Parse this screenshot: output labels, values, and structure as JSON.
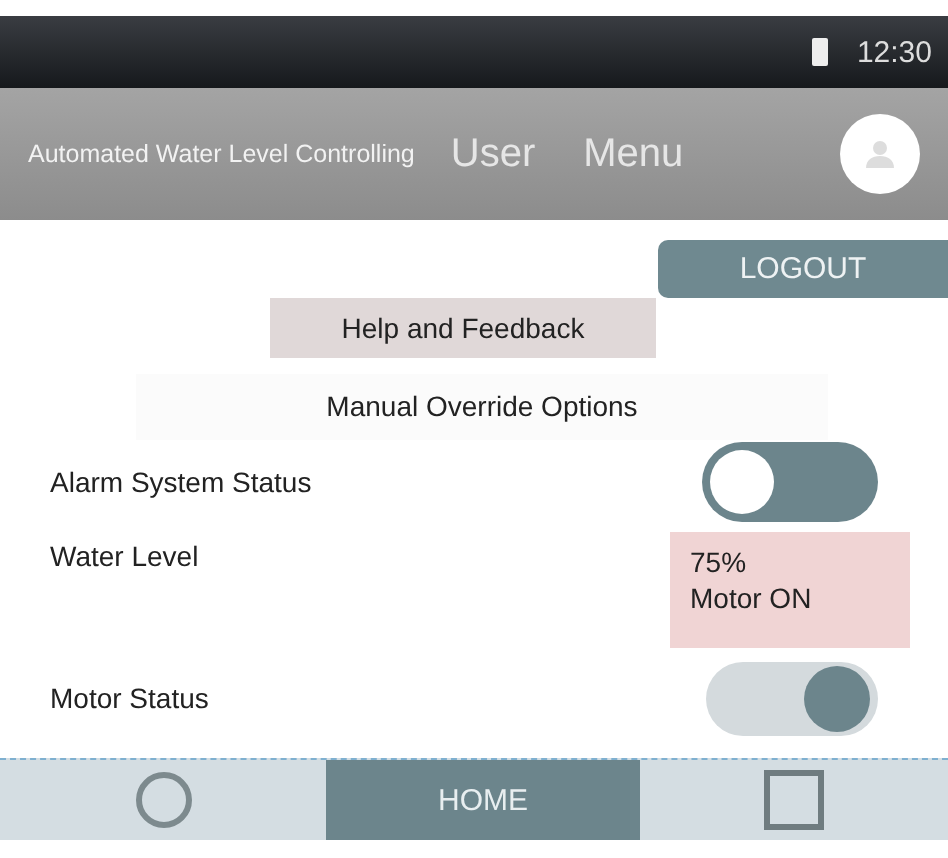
{
  "status_bar": {
    "time": "12:30"
  },
  "header": {
    "title": "Automated Water Level Controlling",
    "links": [
      "User",
      "Menu"
    ]
  },
  "logout_button": "LOGOUT",
  "help_button": "Help and Feedback",
  "section_title": "Manual Override Options",
  "rows": [
    {
      "kind": "toggle",
      "label": "Alarm System Status",
      "on": false
    },
    {
      "kind": "reading",
      "label": "Water Level",
      "lines": [
        "75%",
        "Motor ON"
      ]
    },
    {
      "kind": "toggle",
      "label": "Motor Status",
      "on": true
    }
  ],
  "nav": [
    {
      "kind": "circle",
      "selected": false
    },
    {
      "kind": "text",
      "label": "HOME",
      "selected": true
    },
    {
      "kind": "square",
      "selected": false
    }
  ]
}
